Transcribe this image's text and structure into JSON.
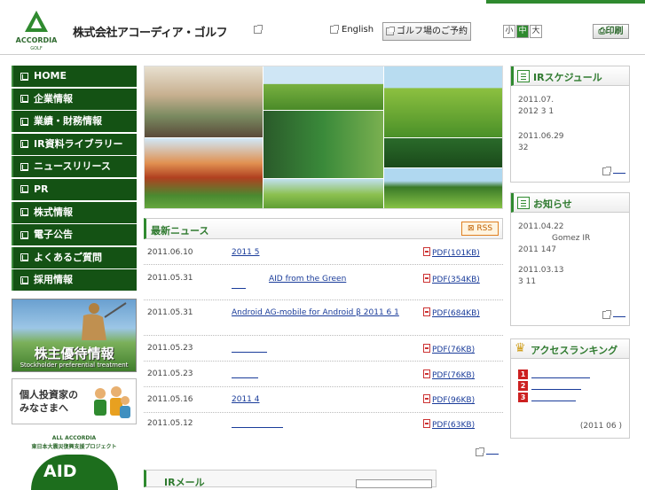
{
  "header": {
    "logo_text": "ACCORDIA",
    "logo_sub": "GOLF",
    "company_name": "株式会社アコーディア・ゴルフ",
    "english_label": "English",
    "golf_reserve_label": "ゴルフ場のご予約",
    "font_sizes": [
      "小",
      "中",
      "大"
    ],
    "print_label": "印刷"
  },
  "sidebar": {
    "items": [
      {
        "label": "HOME"
      },
      {
        "label": "企業情報"
      },
      {
        "label": "業績・財務情報"
      },
      {
        "label": "IR資料ライブラリー"
      },
      {
        "label": "ニュースリリース"
      },
      {
        "label": "PR"
      },
      {
        "label": "株式情報"
      },
      {
        "label": "電子公告"
      },
      {
        "label": "よくあるご質問"
      },
      {
        "label": "採用情報"
      }
    ],
    "banner_shareholder": {
      "title": "株主優待情報",
      "subtitle": "Stockholder preferential treatment"
    },
    "banner_individual": {
      "line1": "個人投資家の",
      "line2": "みなさまへ"
    },
    "banner_aid": {
      "line1": "ALL ACCORDIA",
      "line2": "東日本大震災復興支援プロジェクト",
      "logo": "AID"
    }
  },
  "news": {
    "title": "最新ニュース",
    "rss_label": "RSS",
    "rows": [
      {
        "date": "2011.06.10",
        "title": "2011 5",
        "pdf": "PDF(101KB)"
      },
      {
        "date": "2011.05.31",
        "title": "AID from the Green",
        "pdf": "PDF(354KB)"
      },
      {
        "date": "2011.05.31",
        "title": "Android AG-mobile for Android β 2011 6 1",
        "pdf": "PDF(684KB)"
      },
      {
        "date": "2011.05.23",
        "title": "",
        "pdf": "PDF(76KB)"
      },
      {
        "date": "2011.05.23",
        "title": "",
        "pdf": "PDF(76KB)"
      },
      {
        "date": "2011.05.16",
        "title": "2011 4",
        "pdf": "PDF(96KB)"
      },
      {
        "date": "2011.05.12",
        "title": "",
        "pdf": "PDF(63KB)"
      }
    ]
  },
  "irmail": {
    "title": "IRメール"
  },
  "ir_schedule": {
    "title": "IRスケジュール",
    "items": [
      {
        "date": "2011.07.",
        "text": "2012 3 1"
      },
      {
        "date": "2011.06.29",
        "text": "32"
      }
    ]
  },
  "notices": {
    "title": "お知らせ",
    "items": [
      {
        "date": "2011.04.22",
        "line1": "Gomez IR",
        "line2": "2011 147"
      },
      {
        "date": "2011.03.13",
        "line1": "3 11",
        "line2": ""
      }
    ]
  },
  "ranking": {
    "title": "アクセスランキング",
    "ranks": [
      "1",
      "2",
      "3"
    ],
    "footnote": "(2011 06 )"
  }
}
